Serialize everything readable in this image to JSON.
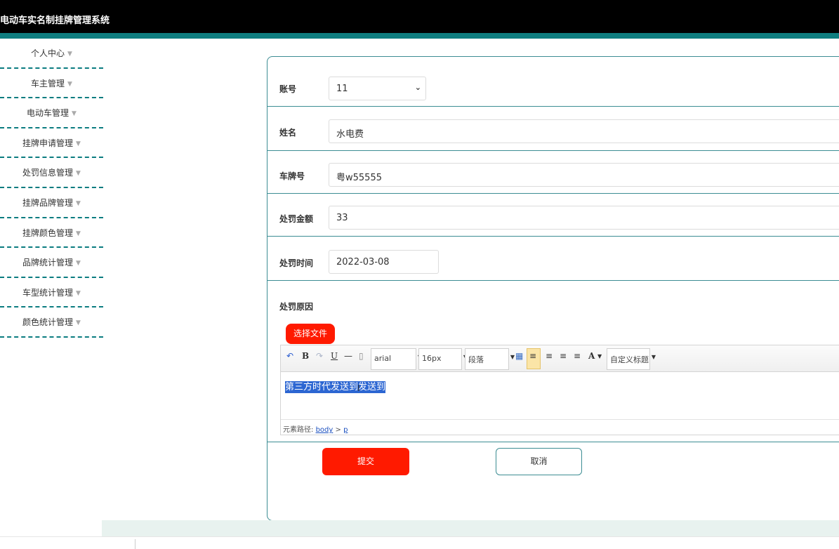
{
  "app": {
    "title": "电动车实名制挂牌管理系统"
  },
  "sidebar": {
    "items": [
      {
        "label": "个人中心"
      },
      {
        "label": "车主管理"
      },
      {
        "label": "电动车管理"
      },
      {
        "label": "挂牌申请管理"
      },
      {
        "label": "处罚信息管理"
      },
      {
        "label": "挂牌品牌管理"
      },
      {
        "label": "挂牌颜色管理"
      },
      {
        "label": "品牌统计管理"
      },
      {
        "label": "车型统计管理"
      },
      {
        "label": "颜色统计管理"
      }
    ]
  },
  "form": {
    "account": {
      "label": "账号",
      "value": "11"
    },
    "name": {
      "label": "姓名",
      "value": "水电费"
    },
    "plate": {
      "label": "车牌号",
      "value": "粤w55555"
    },
    "amount": {
      "label": "处罚金额",
      "value": "33"
    },
    "time": {
      "label": "处罚时间",
      "value": "2022-03-08"
    },
    "reason": {
      "label": "处罚原因"
    },
    "file_button": "选择文件",
    "submit": "提交",
    "cancel": "取消"
  },
  "editor": {
    "font_family": "arial",
    "font_size": "16px",
    "paragraph": "段落",
    "custom_heading": "自定义标题",
    "content": "第三方时代发送到发送到",
    "path_label": "元素路径:",
    "path_body": "body",
    "path_sep": ">",
    "path_p": "p",
    "colors": {
      "selection": "#2c66d2",
      "active_align": "#fbe5a7"
    }
  },
  "colors": {
    "accent": "#0f7d7f",
    "button_red": "#ff1a00",
    "border_teal": "#3c8d93"
  }
}
